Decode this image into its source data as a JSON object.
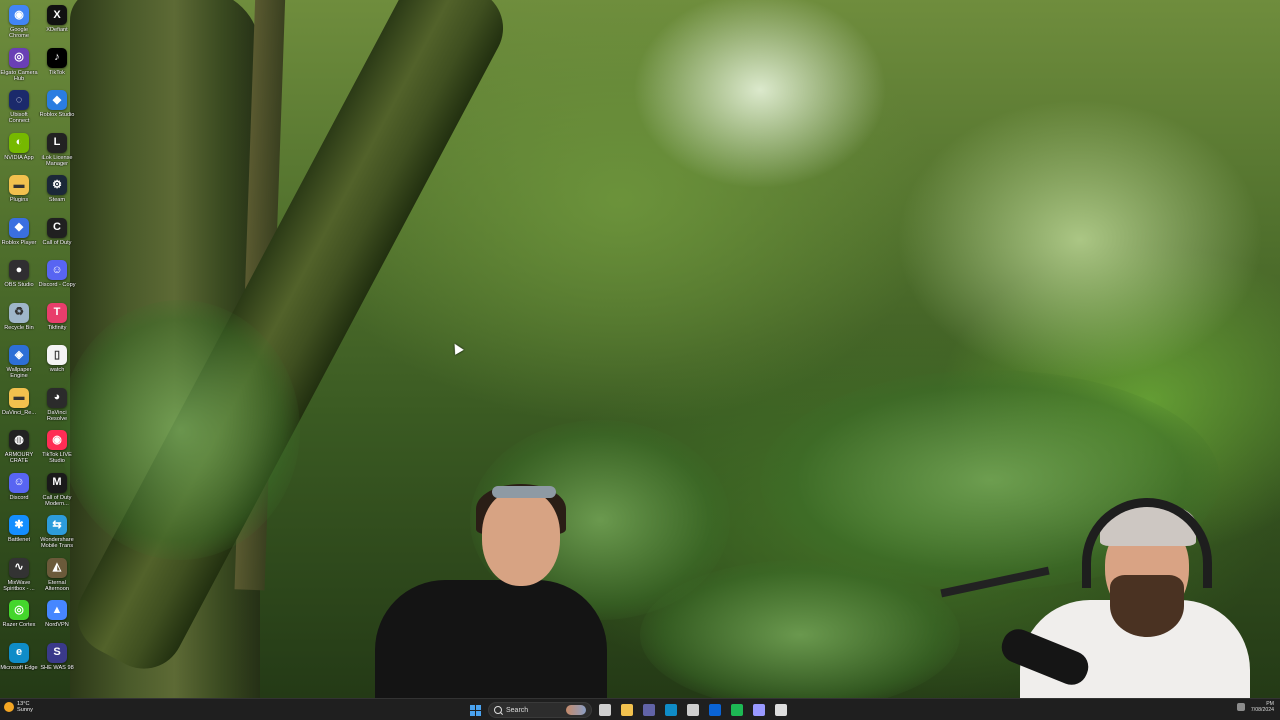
{
  "desktop_icons": [
    {
      "label": "Google Chrome",
      "icon": "chrome-icon",
      "color": "#4285f4",
      "glyph": "◉"
    },
    {
      "label": "XDefiant",
      "icon": "xdefiant-icon",
      "color": "#111111",
      "glyph": "X"
    },
    {
      "label": "Elgato Camera Hub",
      "icon": "elgato-camera-icon",
      "color": "#6a3fb5",
      "glyph": "◎"
    },
    {
      "label": "TikTok",
      "icon": "tiktok-icon",
      "color": "#000000",
      "glyph": "♪"
    },
    {
      "label": "Ubisoft Connect",
      "icon": "ubisoft-icon",
      "color": "#1b2a6b",
      "glyph": "◌"
    },
    {
      "label": "Roblox Studio",
      "icon": "roblox-studio-icon",
      "color": "#2a7de1",
      "glyph": "◆"
    },
    {
      "label": "NVIDIA App",
      "icon": "nvidia-icon",
      "color": "#76b900",
      "glyph": "◐"
    },
    {
      "label": "iLok License Manager",
      "icon": "ilok-icon",
      "color": "#222222",
      "glyph": "L"
    },
    {
      "label": "Plugins",
      "icon": "folder-icon",
      "color": "#f2c14e",
      "glyph": "▬"
    },
    {
      "label": "Steam",
      "icon": "steam-icon",
      "color": "#1b2838",
      "glyph": "⚙"
    },
    {
      "label": "Roblox Player",
      "icon": "roblox-player-icon",
      "color": "#3a6fe0",
      "glyph": "◆"
    },
    {
      "label": "Call of Duty",
      "icon": "call-of-duty-icon",
      "color": "#202020",
      "glyph": "C"
    },
    {
      "label": "OBS Studio",
      "icon": "obs-icon",
      "color": "#302e31",
      "glyph": "●"
    },
    {
      "label": "Discord - Copy",
      "icon": "discord-icon",
      "color": "#5865f2",
      "glyph": "☺"
    },
    {
      "label": "Recycle Bin",
      "icon": "recycle-bin-icon",
      "color": "#9fb6c9",
      "glyph": "♻"
    },
    {
      "label": "Tikfinity",
      "icon": "tikfinity-icon",
      "color": "#e83e6b",
      "glyph": "T"
    },
    {
      "label": "Wallpaper Engine",
      "icon": "wallpaper-engine-icon",
      "color": "#2d6fd6",
      "glyph": "◈"
    },
    {
      "label": "watch",
      "icon": "file-icon",
      "color": "#f4f4f4",
      "glyph": "▯"
    },
    {
      "label": "DaVinci_Re...",
      "icon": "folder-icon",
      "color": "#f2c14e",
      "glyph": "▬"
    },
    {
      "label": "DaVinci Resolve",
      "icon": "davinci-resolve-icon",
      "color": "#2b2b2b",
      "glyph": "◕"
    },
    {
      "label": "ARMOURY CRATE",
      "icon": "armoury-crate-icon",
      "color": "#222222",
      "glyph": "◍"
    },
    {
      "label": "TikTok LIVE Studio",
      "icon": "tiktok-live-icon",
      "color": "#ff2d55",
      "glyph": "◉"
    },
    {
      "label": "Discord",
      "icon": "discord-icon",
      "color": "#5865f2",
      "glyph": "☺"
    },
    {
      "label": "Call of Duty Modern...",
      "icon": "call-of-duty-mw-icon",
      "color": "#1a1a1a",
      "glyph": "M"
    },
    {
      "label": "Battlenet",
      "icon": "battlenet-icon",
      "color": "#148eff",
      "glyph": "✱"
    },
    {
      "label": "Wondershare Mobile Trans",
      "icon": "wondershare-icon",
      "color": "#2d9cdb",
      "glyph": "⇆"
    },
    {
      "label": "MixWave Spiritbox - ...",
      "icon": "mixwave-icon",
      "color": "#333333",
      "glyph": "∿"
    },
    {
      "label": "Eternal Alternoon",
      "icon": "eternal-afternoon-icon",
      "color": "#6b5a3a",
      "glyph": "◭"
    },
    {
      "label": "Razer Cortex",
      "icon": "razer-cortex-icon",
      "color": "#44d62c",
      "glyph": "◎"
    },
    {
      "label": "NordVPN",
      "icon": "nordvpn-icon",
      "color": "#4687ff",
      "glyph": "▲"
    },
    {
      "label": "Microsoft Edge",
      "icon": "edge-icon",
      "color": "#0f8cc8",
      "glyph": "e"
    },
    {
      "label": "SHE WAS 98",
      "icon": "she-was-98-icon",
      "color": "#3a3a8a",
      "glyph": "S"
    }
  ],
  "taskbar": {
    "weather_temp": "13°C",
    "weather_desc": "Sunny",
    "search_placeholder": "Search",
    "apps": [
      {
        "name": "task-view",
        "color": "#cfcfcf"
      },
      {
        "name": "file-explorer",
        "color": "#f2c14e"
      },
      {
        "name": "teams",
        "color": "#6264a7"
      },
      {
        "name": "edge",
        "color": "#0f8cc8"
      },
      {
        "name": "calculator",
        "color": "#cfcfcf"
      },
      {
        "name": "outlook",
        "color": "#0a64d6"
      },
      {
        "name": "spotify",
        "color": "#1db954"
      },
      {
        "name": "premiere",
        "color": "#9999ff"
      },
      {
        "name": "obs",
        "color": "#dddddd"
      }
    ],
    "clock_time": "PM",
    "clock_date": "7/08/2024"
  }
}
